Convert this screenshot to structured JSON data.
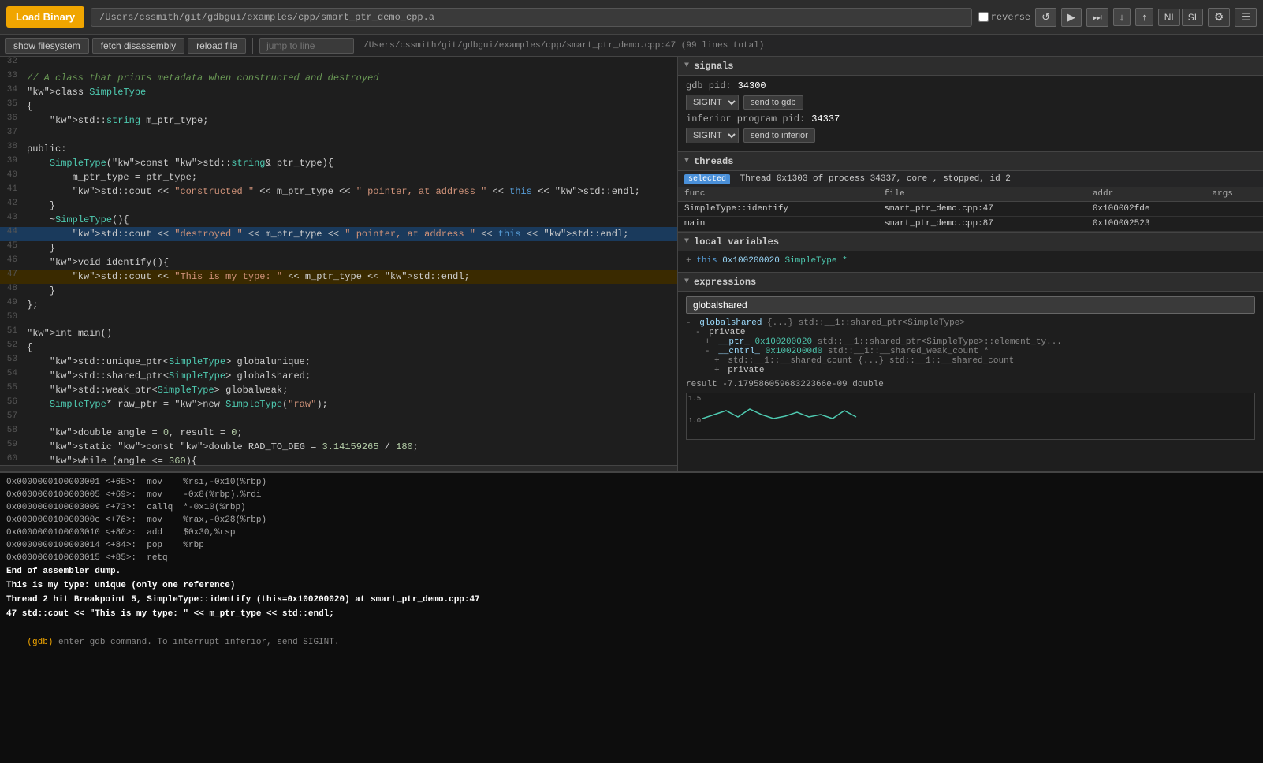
{
  "topbar": {
    "load_binary_label": "Load Binary",
    "filepath": "/Users/cssmith/git/gdbgui/examples/cpp/smart_ptr_demo_cpp.a",
    "reverse_label": "reverse",
    "controls": {
      "refresh": "↺",
      "play": "▶",
      "step_over": "⤼",
      "step_down": "↓",
      "step_up": "↑",
      "ni": "NI",
      "si": "SI",
      "gear": "⚙",
      "menu": "☰"
    }
  },
  "secondbar": {
    "show_filesystem": "show filesystem",
    "fetch_disassembly": "fetch disassembly",
    "reload_file": "reload file",
    "jump_to_line": "jump to line",
    "file_path": "/Users/cssmith/git/gdbgui/examples/cpp/smart_ptr_demo.cpp:47 (99 lines total)"
  },
  "code": {
    "lines": [
      {
        "num": "32",
        "content": "",
        "type": "normal"
      },
      {
        "num": "33",
        "content": "// A class that prints metadata when constructed and destroyed",
        "type": "comment"
      },
      {
        "num": "34",
        "content": "class SimpleType",
        "type": "normal"
      },
      {
        "num": "35",
        "content": "{",
        "type": "normal"
      },
      {
        "num": "36",
        "content": "    std::string m_ptr_type;",
        "type": "normal"
      },
      {
        "num": "37",
        "content": "",
        "type": "normal"
      },
      {
        "num": "38",
        "content": "public:",
        "type": "normal"
      },
      {
        "num": "39",
        "content": "    SimpleType(const std::string& ptr_type){",
        "type": "normal"
      },
      {
        "num": "40",
        "content": "        m_ptr_type = ptr_type;",
        "type": "normal"
      },
      {
        "num": "41",
        "content": "        std::cout << \"constructed \" << m_ptr_type << \" pointer, at address \" << this << std::endl;",
        "type": "normal"
      },
      {
        "num": "42",
        "content": "    }",
        "type": "normal"
      },
      {
        "num": "43",
        "content": "    ~SimpleType(){",
        "type": "normal"
      },
      {
        "num": "44",
        "content": "        std::cout << \"destroyed \" << m_ptr_type << \" pointer, at address \" << this << std::endl;",
        "type": "highlighted"
      },
      {
        "num": "45",
        "content": "    }",
        "type": "normal"
      },
      {
        "num": "46",
        "content": "    void identify(){",
        "type": "normal"
      },
      {
        "num": "47",
        "content": "        std::cout << \"This is my type: \" << m_ptr_type << std::endl;",
        "type": "current"
      },
      {
        "num": "48",
        "content": "    }",
        "type": "normal"
      },
      {
        "num": "49",
        "content": "};",
        "type": "normal"
      },
      {
        "num": "50",
        "content": "",
        "type": "normal"
      },
      {
        "num": "51",
        "content": "int main()",
        "type": "normal"
      },
      {
        "num": "52",
        "content": "{",
        "type": "normal"
      },
      {
        "num": "53",
        "content": "    std::unique_ptr<SimpleType> globalunique;",
        "type": "normal"
      },
      {
        "num": "54",
        "content": "    std::shared_ptr<SimpleType> globalshared;",
        "type": "normal"
      },
      {
        "num": "55",
        "content": "    std::weak_ptr<SimpleType> globalweak;",
        "type": "normal"
      },
      {
        "num": "56",
        "content": "    SimpleType* raw_ptr = new SimpleType(\"raw\");",
        "type": "normal"
      },
      {
        "num": "57",
        "content": "",
        "type": "normal"
      },
      {
        "num": "58",
        "content": "    double angle = 0, result = 0;",
        "type": "normal"
      },
      {
        "num": "59",
        "content": "    static const double RAD_TO_DEG = 3.14159265 / 180;",
        "type": "normal"
      },
      {
        "num": "60",
        "content": "    while (angle <= 360){",
        "type": "normal"
      }
    ]
  },
  "right_panel": {
    "signals": {
      "section_title": "signals",
      "gdb_pid_label": "gdb pid:",
      "gdb_pid_value": "34300",
      "send_to_gdb_label": "send to gdb",
      "signal_options": [
        "SIGINT"
      ],
      "inferior_pid_label": "inferior program pid:",
      "inferior_pid_value": "34337",
      "send_to_inferior_label": "send to inferior",
      "inferior_signal_options": [
        "SIGINT"
      ]
    },
    "threads": {
      "section_title": "threads",
      "selected_label": "selected",
      "thread_info": "Thread 0x1303 of process 34337, core , stopped, id 2",
      "columns": [
        "func",
        "file",
        "addr",
        "args"
      ],
      "rows": [
        {
          "func": "SimpleType::identify",
          "file": "smart_ptr_demo.cpp:47",
          "addr": "0x100002fde",
          "args": ""
        },
        {
          "func": "main",
          "file": "smart_ptr_demo.cpp:87",
          "addr": "0x100002523",
          "args": ""
        }
      ]
    },
    "local_variables": {
      "section_title": "local variables",
      "items": [
        "+ this  0x100200020  SimpleType *"
      ]
    },
    "expressions": {
      "section_title": "expressions",
      "input_value": "globalshared",
      "tree": {
        "root": "- globalshared {...}  std::__1::shared_ptr<SimpleType>",
        "children": [
          "- private",
          "+ __ptr_  0x100200020  std::__1::shared_ptr<SimpleType>::element_ty...",
          "- __cntrl_  0x1002000d0  std::__1::__shared_weak_count *",
          "+ std::__1::__shared_count {...}  std::__1::__shared_count",
          "+ private"
        ]
      },
      "result_label": "result",
      "result_value": "-7.17958605968322366e-09",
      "result_type": "double"
    }
  },
  "bottom_panel": {
    "asm_lines": [
      "0x0000000100003001 <+65>:  mov    %rsi,-0x10(%rbp)",
      "0x0000000100003005 <+69>:  mov    -0x8(%rbp),%rdi",
      "0x0000000100003009 <+73>:  callq  *-0x10(%rbp)",
      "0x000000010000300c <+76>:  mov    %rax,-0x28(%rbp)",
      "0x0000000100003010 <+80>:  add    $0x30,%rsp",
      "0x0000000100003014 <+84>:  pop    %rbp",
      "0x0000000100003015 <+85>:  retq"
    ],
    "messages": [
      "End of assembler dump.",
      "This is my type: unique (only one reference)",
      "",
      "Thread 2 hit Breakpoint 5, SimpleType::identify (this=0x100200020) at smart_ptr_demo.cpp:47",
      "47          std::cout << \"This is my type: \" << m_ptr_type << std::endl;",
      ""
    ],
    "gdb_prompt": "(gdb)",
    "gdb_input": "enter gdb command. To interrupt inferior, send SIGINT."
  }
}
